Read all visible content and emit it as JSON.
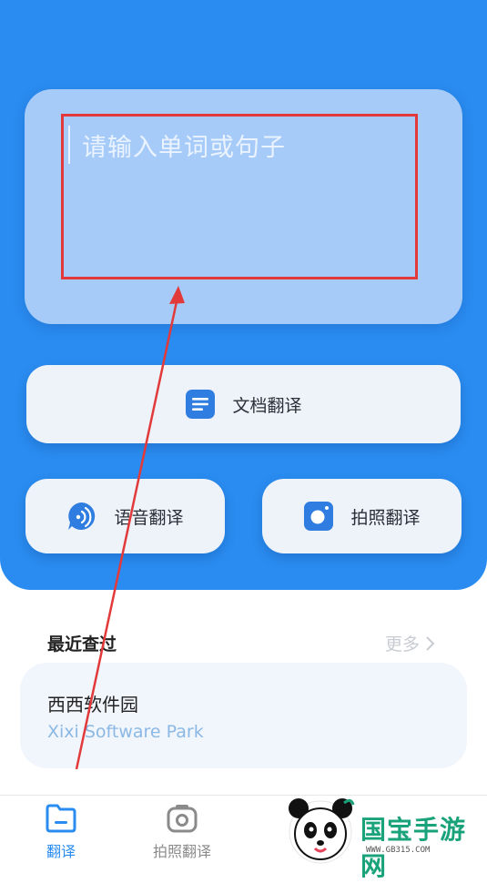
{
  "input": {
    "placeholder": "请输入单词或句子"
  },
  "actions": {
    "doc_translate": "文档翻译",
    "voice_translate": "语音翻译",
    "photo_translate": "拍照翻译"
  },
  "recent": {
    "title": "最近查过",
    "more": "更多",
    "items": [
      {
        "word": "西西软件园",
        "translation": "Xixi Software Park"
      }
    ]
  },
  "tabbar": {
    "tabs": [
      {
        "label": "翻译",
        "icon": "folder-icon",
        "active": true
      },
      {
        "label": "拍照翻译",
        "icon": "camera-icon",
        "active": false
      }
    ]
  },
  "watermark": {
    "brand": "国宝手游网",
    "url": "WWW.GB315.COM"
  },
  "colors": {
    "primary": "#2a8cf0",
    "highlight": "#e23a3a"
  }
}
